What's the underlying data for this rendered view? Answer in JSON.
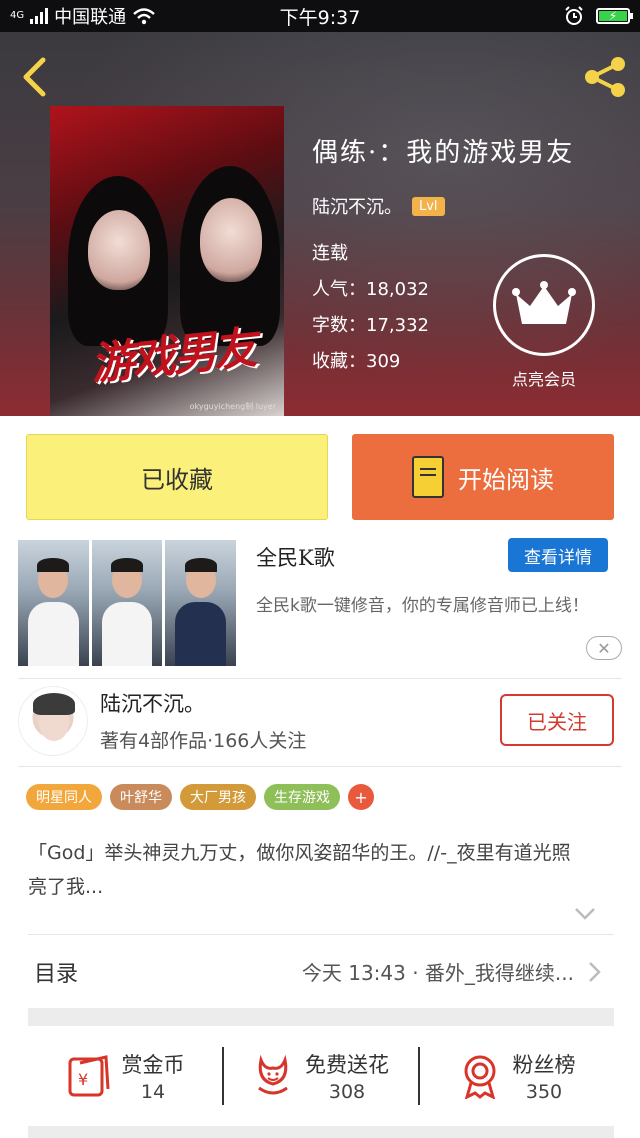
{
  "status_bar": {
    "network": "4G",
    "carrier": "中国联通",
    "time": "下午9:37"
  },
  "header": {
    "book_title": "偶练·：我的游戏男友",
    "author": "陆沉不沉。",
    "level": "Lvl",
    "status": "连载",
    "popularity": "人气：18,032",
    "word_count": "字数：17,332",
    "favorites": "收藏：309",
    "vip_label": "点亮会员",
    "cover_text": "游戏男友",
    "cover_credit": "okyguyicheng制 luyer"
  },
  "actions": {
    "favorite_label": "已收藏",
    "read_label": "开始阅读"
  },
  "ad": {
    "title": "全民K歌",
    "detail_button": "查看详情",
    "description": "全民k歌一键修音，你的专属修音师已上线！"
  },
  "author_card": {
    "name": "陆沉不沉。",
    "works": "著有4部作品·166人关注",
    "follow_label": "已关注"
  },
  "tags": [
    {
      "label": "明星同人",
      "color": "#f2a73c"
    },
    {
      "label": "叶舒华",
      "color": "#c98b5b"
    },
    {
      "label": "大厂男孩",
      "color": "#d39a3a"
    },
    {
      "label": "生存游戏",
      "color": "#8fbf58"
    }
  ],
  "tag_add": "+",
  "intro": "「God」举头神灵九万丈，做你风姿韶华的王。//-_夜里有道光照亮了我...",
  "catalog": {
    "label": "目录",
    "latest": "今天 13:43 · 番外_我得继续..."
  },
  "bottom_stats": [
    {
      "label": "赏金币",
      "value": "14",
      "icon": "red-envelope-icon"
    },
    {
      "label": "免费送花",
      "value": "308",
      "icon": "flower-icon"
    },
    {
      "label": "粉丝榜",
      "value": "350",
      "icon": "medal-icon"
    }
  ],
  "colors": {
    "accent_orange": "#ec6d3e",
    "favorite_yellow": "#fbf07a",
    "follow_red": "#d23b2f",
    "detail_blue": "#1a76d4",
    "icon_yellow": "#f5cf33"
  }
}
